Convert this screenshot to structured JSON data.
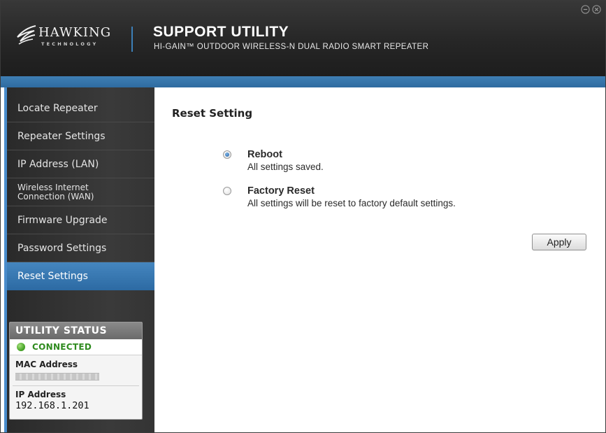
{
  "header": {
    "logo_word": "HAWKING",
    "logo_sub": "TECHNOLOGY",
    "title": "SUPPORT UTILITY",
    "subtitle": "HI-GAIN™ OUTDOOR WIRELESS-N DUAL RADIO SMART REPEATER"
  },
  "sidebar": {
    "items": [
      {
        "label": "Locate Repeater",
        "active": false
      },
      {
        "label": "Repeater Settings",
        "active": false
      },
      {
        "label": "IP Address (LAN)",
        "active": false
      },
      {
        "label": "Wireless Internet\nConnection (WAN)",
        "active": false
      },
      {
        "label": "Firmware Upgrade",
        "active": false
      },
      {
        "label": "Password Settings",
        "active": false
      },
      {
        "label": "Reset Settings",
        "active": true
      }
    ]
  },
  "status": {
    "heading": "UTILITY STATUS",
    "connection": "CONNECTED",
    "connection_color": "#2f8b1f",
    "mac_label": "MAC Address",
    "ip_label": "IP Address",
    "ip_value": "192.168.1.201"
  },
  "main": {
    "section_title": "Reset Setting",
    "options": [
      {
        "title": "Reboot",
        "description": "All settings saved.",
        "selected": true
      },
      {
        "title": "Factory Reset",
        "description": "All settings will be reset to factory default settings.",
        "selected": false
      }
    ],
    "apply_label": "Apply"
  },
  "colors": {
    "accent": "#3f7fb4",
    "header_bg": "#262626",
    "sidebar_bg": "#333333"
  },
  "icons": {
    "minimize": "minimize-circle-icon",
    "close": "close-circle-icon",
    "logo": "hawk-logo-icon"
  }
}
